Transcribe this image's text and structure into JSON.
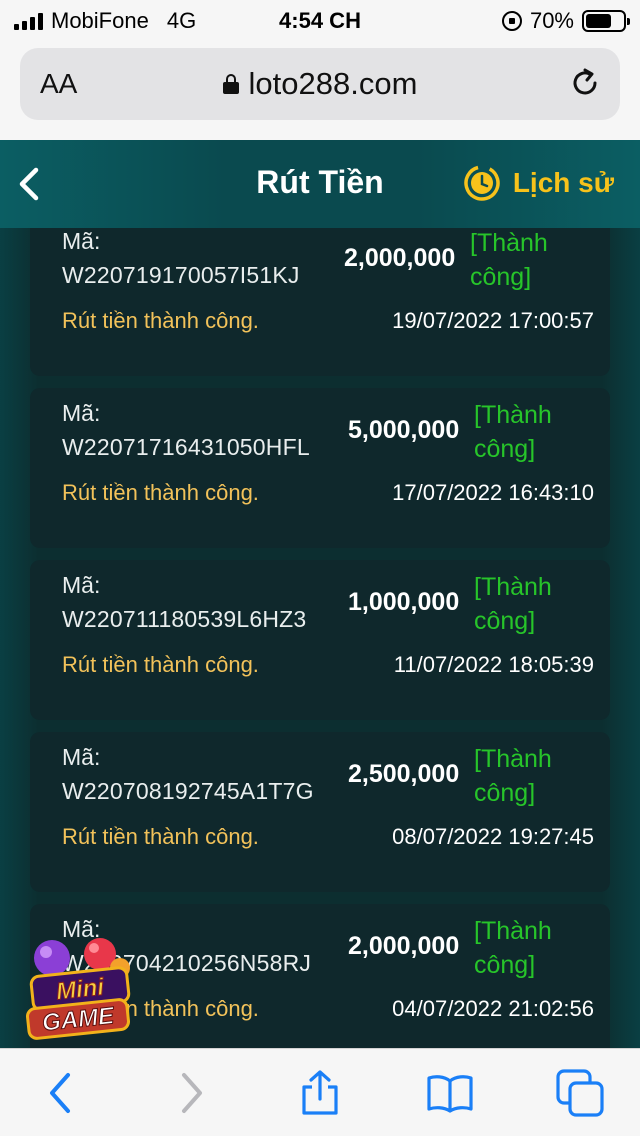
{
  "status_bar": {
    "carrier": "MobiFone",
    "network": "4G",
    "time": "4:54 CH",
    "battery": "70%",
    "battery_level": 0.7
  },
  "browser": {
    "aa_label": "AA",
    "url": "loto288.com"
  },
  "header": {
    "title": "Rút Tiền",
    "history_label": "Lịch sử"
  },
  "withdrawals": [
    {
      "ma_label": "Mã:",
      "code": "W220719170057I51KJ",
      "amount": "2,000,000",
      "status_line1": "[Thành",
      "status_line2": "công]",
      "message": "Rút tiền thành công.",
      "time": "19/07/2022 17:00:57"
    },
    {
      "ma_label": "Mã:",
      "code": "W22071716431050HFL",
      "amount": "5,000,000",
      "status_line1": "[Thành",
      "status_line2": "công]",
      "message": "Rút tiền thành công.",
      "time": "17/07/2022 16:43:10"
    },
    {
      "ma_label": "Mã:",
      "code": "W220711180539L6HZ3",
      "amount": "1,000,000",
      "status_line1": "[Thành",
      "status_line2": "công]",
      "message": "Rút tiền thành công.",
      "time": "11/07/2022 18:05:39"
    },
    {
      "ma_label": "Mã:",
      "code": "W220708192745A1T7G",
      "amount": "2,500,000",
      "status_line1": "[Thành",
      "status_line2": "công]",
      "message": "Rút tiền thành công.",
      "time": "08/07/2022 19:27:45"
    },
    {
      "ma_label": "Mã:",
      "code": "W220704210256N58RJ",
      "amount": "2,000,000",
      "status_line1": "[Thành",
      "status_line2": "công]",
      "message": "Rút tiền thành công.",
      "time": "04/07/2022 21:02:56"
    }
  ],
  "mini_game": {
    "line1": "Mini",
    "line2": "GAME"
  },
  "colors": {
    "accent_gold": "#f7c21b",
    "success_green": "#27c52a",
    "message_gold": "#f2c25a",
    "card_bg": "#0f282c",
    "header_teal": "#0b5e63",
    "ios_blue": "#1a7ff7"
  }
}
